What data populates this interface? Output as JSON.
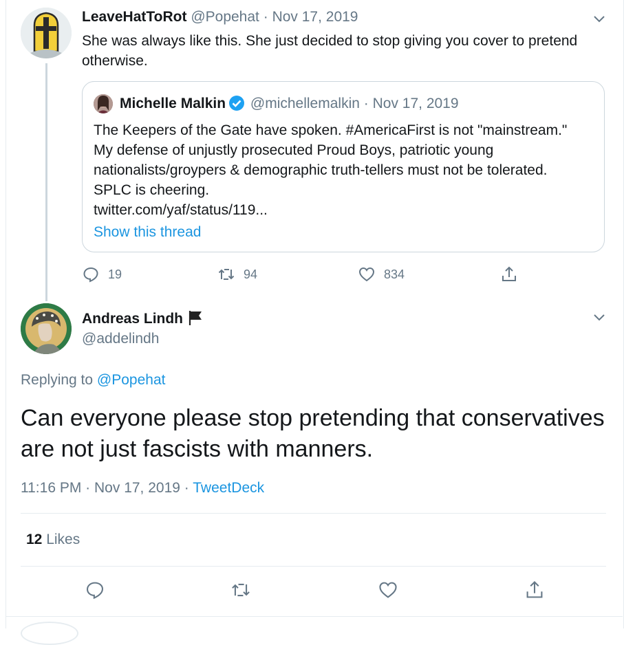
{
  "quoting_tweet": {
    "display_name": "LeaveHatToRot",
    "handle": "@Popehat",
    "separator": "·",
    "date": "Nov 17, 2019",
    "text": "She was always like this. She just decided to stop giving you cover to pretend otherwise.",
    "quoted_tweet": {
      "display_name": "Michelle Malkin",
      "handle": "@michellemalkin",
      "separator": "·",
      "date": "Nov 17, 2019",
      "text_lines": [
        "The Keepers of the Gate have spoken. #AmericaFirst is not \"mainstream.\"",
        "My defense of unjustly prosecuted Proud Boys, patriotic young",
        "nationalists/groypers & demographic truth-tellers must not be tolerated.",
        "SPLC is cheering.",
        "twitter.com/yaf/status/119..."
      ],
      "show_thread": "Show this thread"
    },
    "counts": {
      "replies": "19",
      "retweets": "94",
      "likes": "834"
    }
  },
  "main_tweet": {
    "display_name": "Andreas Lindh",
    "handle": "@addelindh",
    "replying_prefix": "Replying to",
    "replying_to": "@Popehat",
    "text_lines": [
      "Can everyone please stop pretending that conservatives",
      "are not just fascists with manners."
    ],
    "time": "11:16 PM",
    "separator": "·",
    "date": "Nov 17, 2019",
    "source": "TweetDeck",
    "likes_count": "12",
    "likes_label": "Likes"
  },
  "icons": {
    "caret": "chevron-down-icon",
    "reply": "reply-icon",
    "retweet": "retweet-icon",
    "like": "heart-icon",
    "share": "share-icon",
    "verified": "verified-badge-icon",
    "flag": "black-flag-icon"
  },
  "colors": {
    "link": "#1b95e0",
    "muted": "#657786",
    "text": "#14171a",
    "border": "#e6ecf0",
    "verified": "#1da1f2"
  }
}
